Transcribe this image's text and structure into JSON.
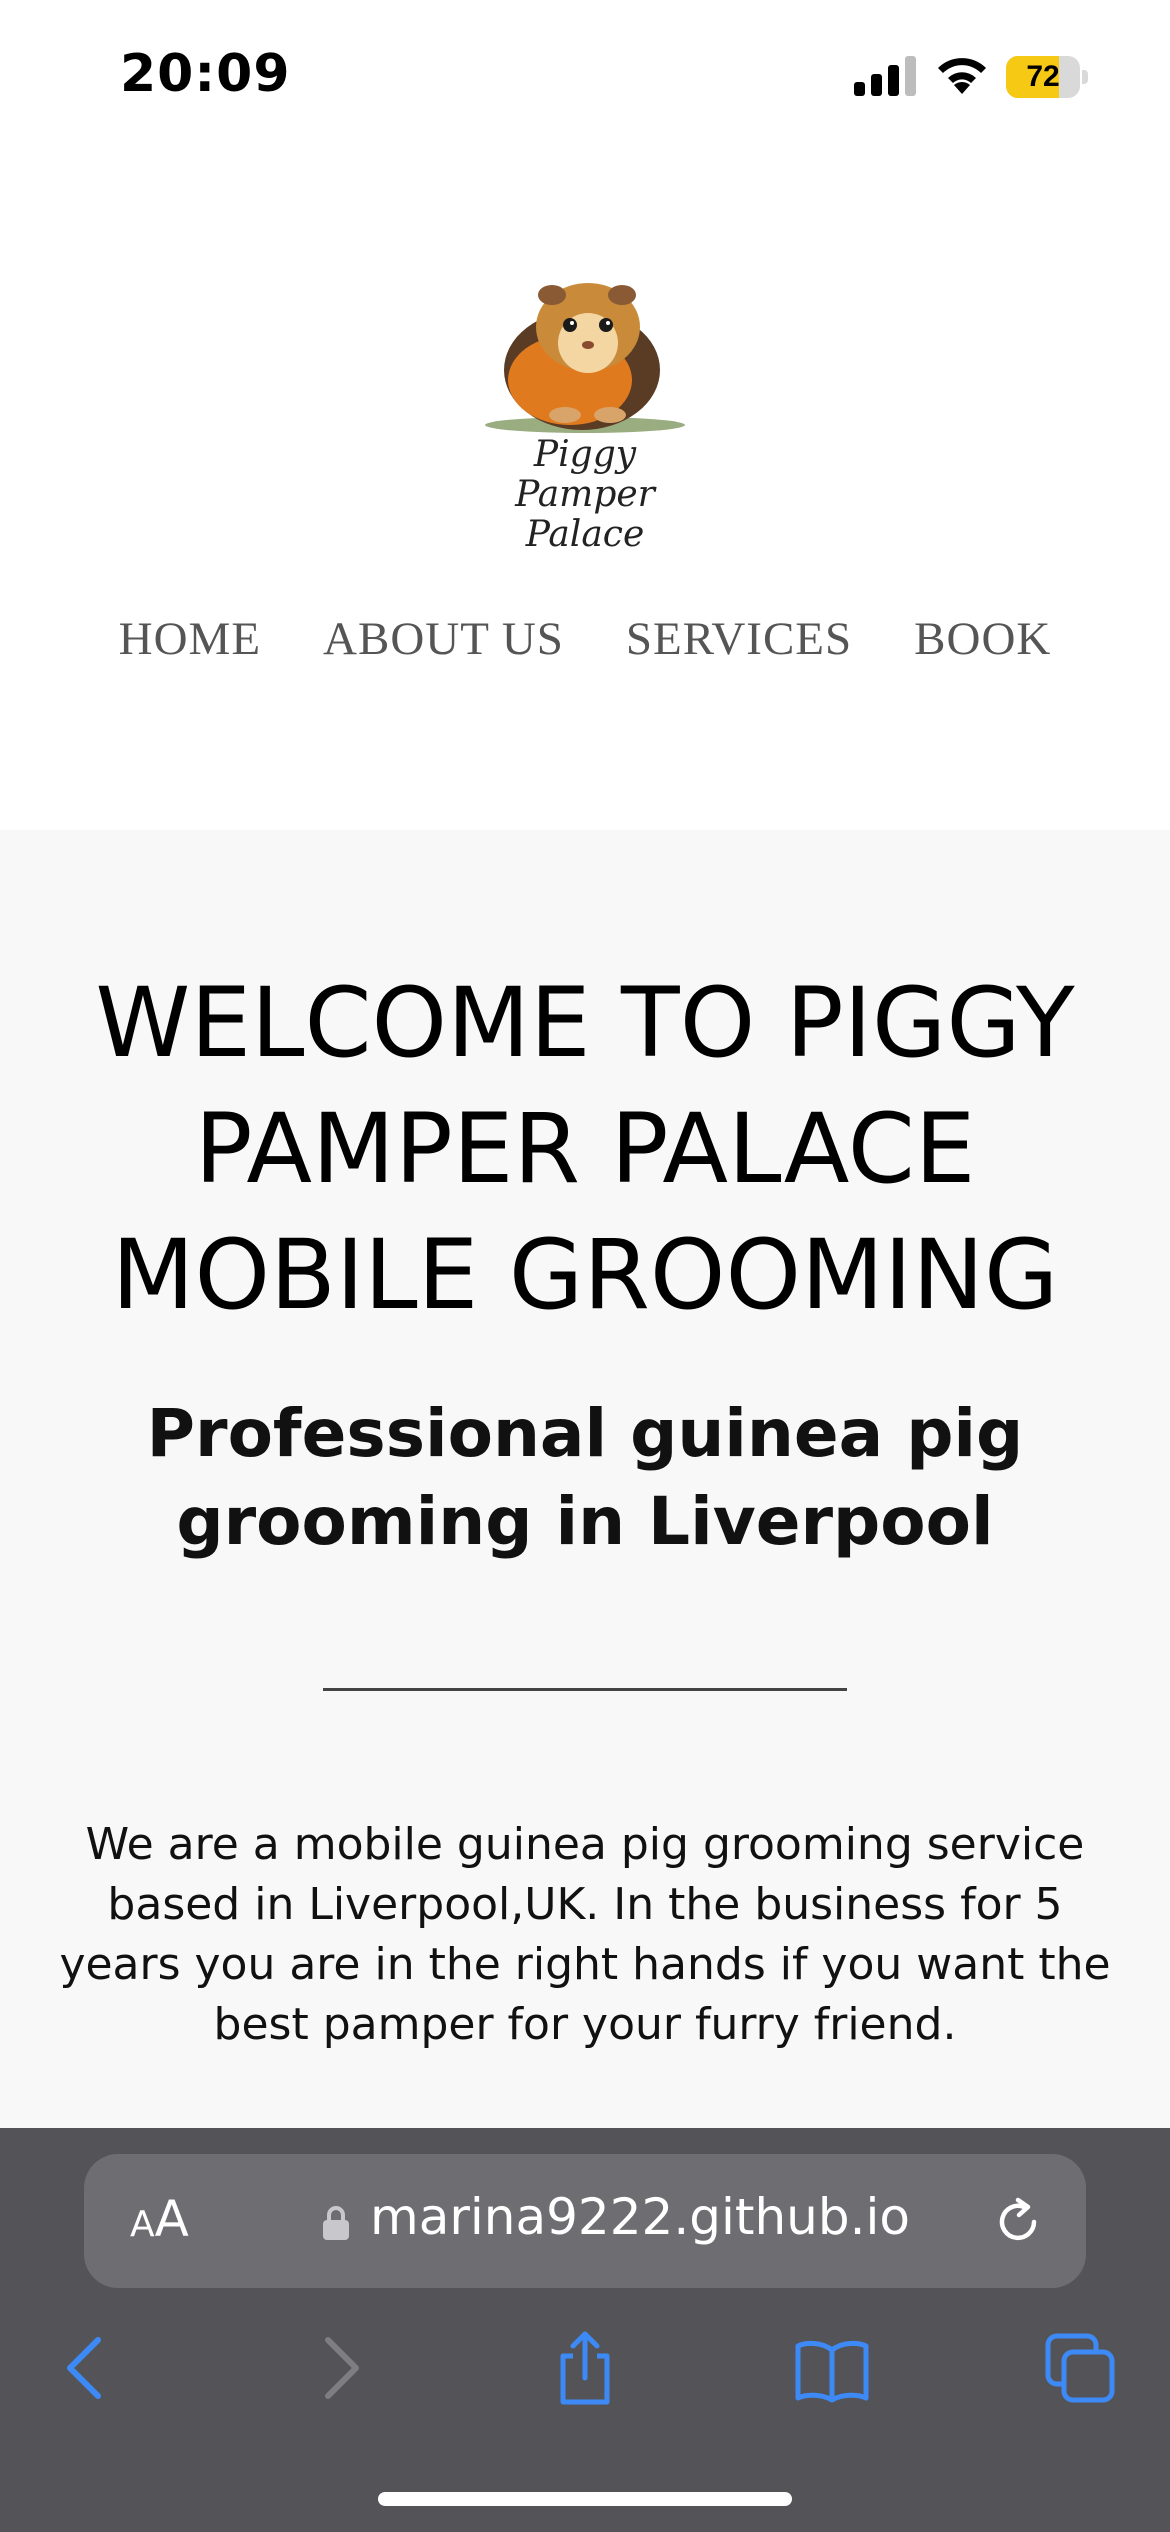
{
  "status_bar": {
    "time": "20:09",
    "battery_level": "72",
    "battery_fraction": 0.72,
    "battery_color": "#f6c915"
  },
  "header": {
    "logo": {
      "icon": "guinea-pig-icon",
      "line1": "Piggy Pamper",
      "line2": "Palace"
    },
    "nav": [
      {
        "label": "HOME"
      },
      {
        "label": "ABOUT US"
      },
      {
        "label": "SERVICES"
      },
      {
        "label": "BOOK"
      }
    ]
  },
  "hero": {
    "title": "WELCOME TO PIGGY PAMPER PALACE MOBILE GROOMING",
    "subtitle": "Professional guinea pig grooming in Liverpool",
    "description": "We are a mobile guinea pig grooming service based in Liverpool,UK. In the business for 5 years you are in the right hands if you want the best pamper for your furry friend."
  },
  "browser": {
    "text_size_button_small": "A",
    "text_size_button_large": "A",
    "url": "marina9222.github.io",
    "icons": [
      "lock-icon",
      "reload-icon",
      "back-icon",
      "forward-icon",
      "share-icon",
      "bookmarks-icon",
      "tabs-icon"
    ],
    "accent_color": "#3d8af7"
  }
}
